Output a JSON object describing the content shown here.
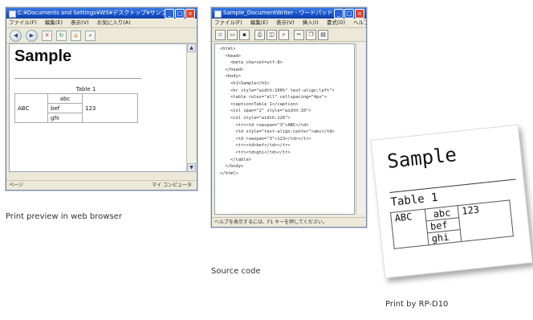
{
  "browser": {
    "title": "C:¥Documents and Settings¥WS¥デスクトップ¥サンプル",
    "menu": [
      "ファイル(F)",
      "編集(E)",
      "表示(V)",
      "お気に入り(A)"
    ],
    "page_heading": "Sample",
    "table_caption": "Table 1",
    "table": {
      "row_header": "ABC",
      "cells": [
        "abc",
        "bef",
        "ghi"
      ],
      "value": "123"
    },
    "status_text": "ページ",
    "status_zone": "マイ コンピュータ"
  },
  "editor": {
    "title": "Sample_DocumentWriter - ワードパッド",
    "menu": [
      "ファイル(F)",
      "編集(E)",
      "表示(V)",
      "挿入(I)",
      "書式(O)",
      "ヘルプ(H)"
    ],
    "code_lines": [
      "<html>",
      "  <head>",
      "    <meta charset=utf-8>",
      "  </head>",
      "  <body>",
      "    <h1>Sample</h1>",
      "    <hr style=\"width:100%\" text-align:left\">",
      "    <table rules=\"all\" cellspacing=\"4px\">",
      "    <caption>Table 1</caption>",
      "    <col span=\"2\" style=\"width:10\">",
      "    <col style=\"width:120\">",
      "      <tr><td rowspan=\"3\">ABC</td>",
      "      <td style=\"text-align:center\">abc</td>",
      "      <td rowspan=\"3\">123</td></tr>",
      "      <tr><td>bef</td></tr>",
      "      <tr><td>ghi</td></tr>",
      "    </table>",
      "  </body>",
      "</html>"
    ],
    "status_text": "ヘルプを表示するには、F1 キーを押してください。"
  },
  "receipt": {
    "heading": "Sample",
    "caption": "Table 1",
    "table": {
      "row_header": "ABC",
      "cells": [
        "abc",
        "bef",
        "ghi"
      ],
      "value": "123"
    }
  },
  "captions": {
    "browser": "Print preview in web browser",
    "source": "Source code",
    "printer": "Print by RP-D10"
  },
  "icons": {
    "back": "back-arrow-icon",
    "forward": "forward-arrow-icon",
    "stop": "stop-icon",
    "refresh": "refresh-icon",
    "home": "home-icon",
    "search": "search-icon"
  }
}
